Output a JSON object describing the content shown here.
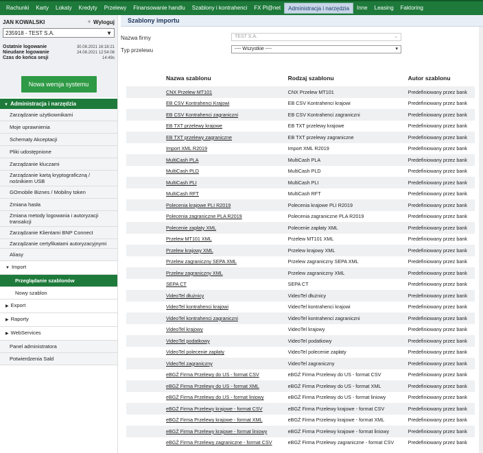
{
  "topnav": [
    {
      "label": "Rachunki"
    },
    {
      "label": "Karty"
    },
    {
      "label": "Lokaty"
    },
    {
      "label": "Kredyty"
    },
    {
      "label": "Przelewy"
    },
    {
      "label": "Finansowanie handlu"
    },
    {
      "label": "Szablony i kontrahenci"
    },
    {
      "label": "FX Pl@net"
    },
    {
      "label": "Administracja i narzędzia"
    },
    {
      "label": "Inne"
    },
    {
      "label": "Leasing"
    },
    {
      "label": "Faktoring"
    }
  ],
  "user": {
    "name": "JAN KOWALSKI",
    "logout_label": "Wyloguj",
    "account": "235918 - TEST S.A.",
    "last_login_label": "Ostatnie logowanie",
    "last_login_value": "30.08.2021 16:18:21",
    "failed_login_label": "Nieudane logowanie",
    "failed_login_value": "24.08.2021 12:54:08",
    "session_end_label": "Czas do końca sesji",
    "session_end_value": "14:49s"
  },
  "new_version_label": "Nowa wersja systemu",
  "menu": {
    "section": "Administracja i narzędzia",
    "items": [
      "Zarządzanie użytkownikami",
      "Moje uprawnienia",
      "Schematy Akceptacji",
      "Pliki udostępnione",
      "Zarządzanie kluczami",
      "Zarządzanie kartą kryptograficzną / nośnikiem USB",
      "GOmobile Biznes / Mobilny token",
      "Zmiana hasła",
      "Zmiana metody logowania i autoryzacji transakcji",
      "Zarządzanie Klientami BNP Connect",
      "Zarządzanie certyfikatami autoryzacyjnymi",
      "Aliasy"
    ],
    "import_label": "Import",
    "import_sub": [
      "Przeglądanie szablonów",
      "Nowy szablon"
    ],
    "groups": [
      "Export",
      "Raporty",
      "WebServices"
    ],
    "bottom": [
      "Panel administratora",
      "Potwierdzenia Sald"
    ]
  },
  "page_title": "Szablony importu",
  "form": {
    "company_label": "Nazwa firmy",
    "company_value": "TEST S.A.",
    "type_label": "Typ przelewu",
    "type_value": "---- Wszystkie ----"
  },
  "table": {
    "headers": [
      "Nazwa szablonu",
      "Rodzaj szablonu",
      "Autor szablonu"
    ],
    "rows": [
      [
        "CNX Przelew MT101",
        "CNX Przelew MT101",
        "Predefiniowany przez bank"
      ],
      [
        "EB CSV Kontrahenci Krajowi",
        "EB CSV Kontrahenci krajowi",
        "Predefiniowany przez bank"
      ],
      [
        "EB CSV Kontrahenci zagraniczni",
        "EB CSV Kontrahenci zagraniczni",
        "Predefiniowany przez bank"
      ],
      [
        "EB TXT przelewy krajowe",
        "EB TXT przelewy krajowe",
        "Predefiniowany przez bank"
      ],
      [
        "EB TXT przelewy zagraniczne",
        "EB TXT przelewy zagraniczne",
        "Predefiniowany przez bank"
      ],
      [
        "Import XML R2019",
        "Import XML R2019",
        "Predefiniowany przez bank"
      ],
      [
        "MultiCash PLA",
        "MultiCash PLA",
        "Predefiniowany przez bank"
      ],
      [
        "MultiCash PLD",
        "MultiCash PLD",
        "Predefiniowany przez bank"
      ],
      [
        "MultiCash PLI",
        "MultiCash PLI",
        "Predefiniowany przez bank"
      ],
      [
        "MultiCash RFT",
        "MultiCash RFT",
        "Predefiniowany przez bank"
      ],
      [
        "Polecenia krajowe PLI R2019",
        "Polecenia krajowe PLI R2019",
        "Predefiniowany przez bank"
      ],
      [
        "Polecenia zagraniczne PLA R2019",
        "Polecenia zagraniczne PLA R2019",
        "Predefiniowany przez bank"
      ],
      [
        "Polecenie zapłaty XML",
        "Polecenie zapłaty XML",
        "Predefiniowany przez bank"
      ],
      [
        "Przelew MT101 XML",
        "Przelew MT101 XML",
        "Predefiniowany przez bank"
      ],
      [
        "Przelew krajowy XML",
        "Przelew krajowy XML",
        "Predefiniowany przez bank"
      ],
      [
        "Przelew zagraniczny SEPA XML",
        "Przelew zagraniczny SEPA XML",
        "Predefiniowany przez bank"
      ],
      [
        "Przelew zagraniczny XML",
        "Przelew zagraniczny XML",
        "Predefiniowany przez bank"
      ],
      [
        "SEPA CT",
        "SEPA CT",
        "Predefiniowany przez bank"
      ],
      [
        "VideoTel dłużnicy",
        "VideoTel dłużnicy",
        "Predefiniowany przez bank"
      ],
      [
        "VideoTel kontrahenci krajowi",
        "VideoTel kontrahenci krajowi",
        "Predefiniowany przez bank"
      ],
      [
        "VideoTel kontrahenci zagraniczni",
        "VideoTel kontrahenci zagraniczni",
        "Predefiniowany przez bank"
      ],
      [
        "VideoTel krajowy",
        "VideoTel krajowy",
        "Predefiniowany przez bank"
      ],
      [
        "VideoTel podatkowy",
        "VideoTel podatkowy",
        "Predefiniowany przez bank"
      ],
      [
        "VideoTel polecenie zapłaty",
        "VideoTel polecenie zapłaty",
        "Predefiniowany przez bank"
      ],
      [
        "VideoTel zagraniczny",
        "VideoTel zagraniczny",
        "Predefiniowany przez bank"
      ],
      [
        "eBGŻ Firma Przelewy do US - format CSV",
        "eBGŻ Firma Przelewy do US - format CSV",
        "Predefiniowany przez bank"
      ],
      [
        "eBGŻ Firma Przelewy do US - format XML",
        "eBGŻ Firma Przelewy do US - format XML",
        "Predefiniowany przez bank"
      ],
      [
        "eBGŻ Firma Przelewy do US - format liniowy",
        "eBGŻ Firma Przelewy do US - format liniowy",
        "Predefiniowany przez bank"
      ],
      [
        "eBGŻ Firma Przelewy krajowe - format CSV",
        "eBGŻ Firma Przelewy krajowe - format CSV",
        "Predefiniowany przez bank"
      ],
      [
        "eBGŻ Firma Przelewy krajowe - format XML",
        "eBGŻ Firma Przelewy krajowe - format XML",
        "Predefiniowany przez bank"
      ],
      [
        "eBGŻ Firma Przelewy krajowe - format liniowy",
        "eBGŻ Firma Przelewy krajowe - format liniowy",
        "Predefiniowany przez bank"
      ],
      [
        "eBGŻ Firma Przelewy zagraniczne - format CSV",
        "eBGŻ Firma Przelewy zagraniczne - format CSV",
        "Predefiniowany przez bank"
      ]
    ]
  }
}
